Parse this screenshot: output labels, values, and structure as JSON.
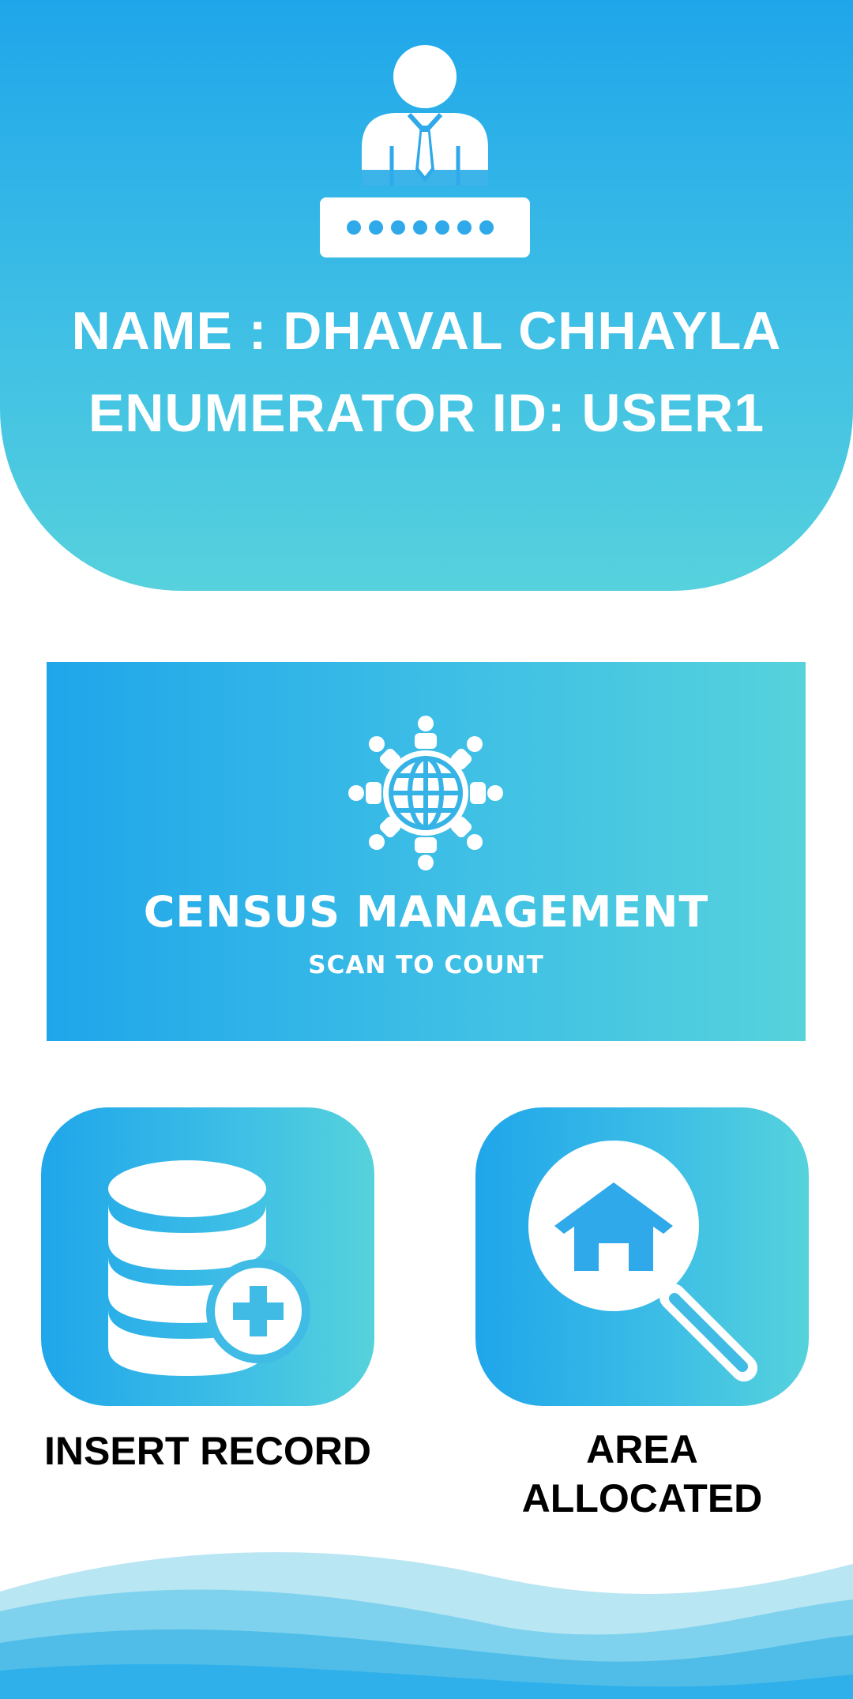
{
  "header": {
    "name_line": "NAME : DHAVAL CHHAYLA",
    "id_line": "ENUMERATOR ID: USER1",
    "icon": "user-password-icon"
  },
  "census": {
    "title": "CENSUS MANAGEMENT",
    "subtitle": "SCAN TO COUNT",
    "icon": "globe-people-icon"
  },
  "tiles": [
    {
      "label": "INSERT RECORD",
      "icon": "database-add-icon"
    },
    {
      "label": "AREA\nALLOCATED",
      "icon": "home-search-icon"
    }
  ],
  "colors": {
    "gradient_start": "#1fa6ea",
    "gradient_end": "#56d2dc",
    "wave_light": "#b8e6f3"
  }
}
